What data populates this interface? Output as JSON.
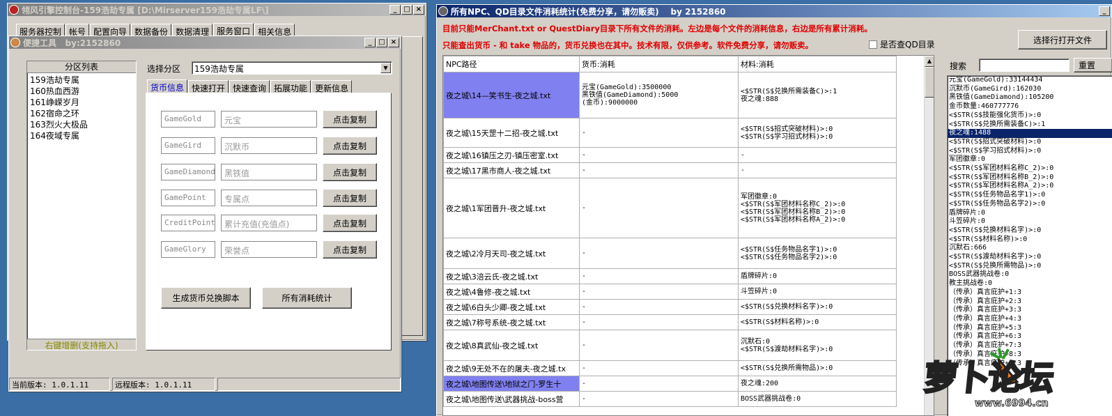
{
  "main_window": {
    "title": "翎风引擎控制台-159浩劫专属 [D:\\Mirserver159浩劫专属LF\\]",
    "tabs": [
      "服务器控制",
      "帐号",
      "配置向导",
      "数据备份",
      "数据清理",
      "服务窗口",
      "相关信息"
    ]
  },
  "quick_tool": {
    "title": "便捷工具   by:2152860",
    "zone_list_header": "分区列表",
    "zones": [
      "159浩劫专属",
      "160热血西游",
      "161峥嵘岁月",
      "162宿命之环",
      "163烈火大极品",
      "164夜域专属"
    ],
    "zone_list_footer": "右键增删(支持拖入)",
    "select_zone_label": "选择分区",
    "selected_zone": "159浩劫专属",
    "tabs": [
      "货币信息",
      "快速打开",
      "快速查询",
      "拓展功能",
      "更新信息"
    ],
    "currency_rows": [
      {
        "key": "GameGold",
        "name": "元宝",
        "btn": "点击复制"
      },
      {
        "key": "GameGird",
        "name": "沉默币",
        "btn": "点击复制"
      },
      {
        "key": "GameDiamond",
        "name": "黑铁值",
        "btn": "点击复制"
      },
      {
        "key": "GamePoint",
        "name": "专属点",
        "btn": "点击复制"
      },
      {
        "key": "CreditPoint",
        "name": "累计充值(充值点)",
        "btn": "点击复制"
      },
      {
        "key": "GameGlory",
        "name": "荣誉点",
        "btn": "点击复制"
      }
    ],
    "gen_script_button": "生成货币兑换脚本",
    "all_stats_button": "所有消耗统计",
    "current_version": "当前版本: 1.0.1.11",
    "remote_version": "远程版本: 1.0.1.11"
  },
  "stats_window": {
    "title": "所有NPC、QD目录文件消耗统计(免费分享，请勿贩卖)    by 2152860",
    "notice_line1": "目前只能MerChant.txt or QuestDiary目录下所有文件的消耗。左边是每个文件的消耗信息，右边是所有累计消耗。",
    "notice_line2": "只能查出货币 - 和 take 物品的，货币兑换也在其中。技术有限，仅供参考。软件免费分享，请勿贩卖。",
    "qd_checkbox_label": "是否查QD目录",
    "select_file_button": "选择行打开文件",
    "search_label": "搜索",
    "search_value": "",
    "reset_button": "重置",
    "columns": [
      "NPC路径",
      "货币:消耗",
      "材料:消耗"
    ],
    "rows": [
      {
        "path": "夜之城\\14—笑书生-夜之城.txt",
        "currency": "元宝(GameGold):3500000\n黑铁值(GameDiamond):5000\n(金币):9000000",
        "material": "<$STR(S$兑换所需装备C)>:1\n夜之魂:888"
      },
      {
        "path": "夜之城\\15天罡十二招-夜之城.txt",
        "currency": "-",
        "material": "<$STR(S$招式突破材料)>:0\n<$STR(S$学习招式材料)>:0"
      },
      {
        "path": "夜之城\\16镇压之刃-镇压密室.txt",
        "currency": "-",
        "material": "-"
      },
      {
        "path": "夜之城\\17黑市商人-夜之城.txt",
        "currency": "-",
        "material": "-"
      },
      {
        "path": "夜之城\\1军团晋升-夜之城.txt",
        "currency": "-",
        "material": "军团徽章:0\n<$STR(S$军团材料名称C_2)>:0\n<$STR(S$军团材料名称B_2)>:0\n<$STR(S$军团材料名称A_2)>:0"
      },
      {
        "path": "夜之城\\2冷月天司-夜之城.txt",
        "currency": "-",
        "material": "<$STR(S$任务物品名字1)>:0\n<$STR(S$任务物品名字2)>:0"
      },
      {
        "path": "夜之城\\3涪云氏-夜之城.txt",
        "currency": "-",
        "material": "盾牌碎片:0"
      },
      {
        "path": "夜之城\\4鲁修-夜之城.txt",
        "currency": "-",
        "material": "斗笠碎片:0"
      },
      {
        "path": "夜之城\\6白头少卿-夜之城.txt",
        "currency": "-",
        "material": "<$STR(S$兑换材料名字)>:0"
      },
      {
        "path": "夜之城\\7称号系统-夜之城.txt",
        "currency": "-",
        "material": "<$STR(S$材料名称)>:0"
      },
      {
        "path": "夜之城\\8真武仙-夜之城.txt",
        "currency": "-",
        "material": "沉默石:0\n<$STR(S$渡劫材料名字)>:0"
      },
      {
        "path": "夜之城\\9无处不在的屠夫-夜之城.tx",
        "currency": "-",
        "material": "<$STR(S$兑换所需物品)>:0"
      },
      {
        "path": "夜之城\\地图传送\\地狱之门-罗生十",
        "currency": "-",
        "material": "夜之魂:200"
      },
      {
        "path": "夜之城\\地图传送\\武器挑战-boss营",
        "currency": "-",
        "material": "BOSS武器挑战卷:0"
      }
    ],
    "totals": [
      "元宝(GameGold):33144434",
      "沉默币(GameGird):162030",
      "黑铁值(GameDiamond):105200",
      "金币数量:460777776",
      "<$STR(S$技能强化货币)>:0",
      "<$STR(S$兑换所需装备C)>:1",
      "夜之魂:1488",
      "<$STR(S$招式突破材料)>:0",
      "<$STR(S$学习招式材料)>:0",
      "军团徽章:0",
      "<$STR(S$军团材料名称C_2)>:0",
      "<$STR(S$军团材料名称B_2)>:0",
      "<$STR(S$军团材料名称A_2)>:0",
      "<$STR(S$任务物品名字1)>:0",
      "<$STR(S$任务物品名字2)>:0",
      "盾牌碎片:0",
      "斗笠碎片:0",
      "<$STR(S$兑换材料名字)>:0",
      "<$STR(S$材料名称)>:0",
      "沉默石:666",
      "<$STR(S$渡劫材料名字)>:0",
      "<$STR(S$兑换所需物品)>:0",
      "BOSS武器挑战卷:0",
      "教主挑战卷:0",
      "（传承）真言庇护+1:3",
      "（传承）真言庇护+2:3",
      "（传承）真言庇护+3:3",
      "（传承）真言庇护+4:3",
      "（传承）真言庇护+5:3",
      "（传承）真言庇护+6:3",
      "（传承）真言庇护+7:3",
      "（传承）真言庇护+8:3",
      "（传承）真言庇护+9:3"
    ],
    "totals_selected_index": 6
  },
  "watermark": {
    "logo_text": "萝卜论坛",
    "url": "www.6994.cn"
  }
}
